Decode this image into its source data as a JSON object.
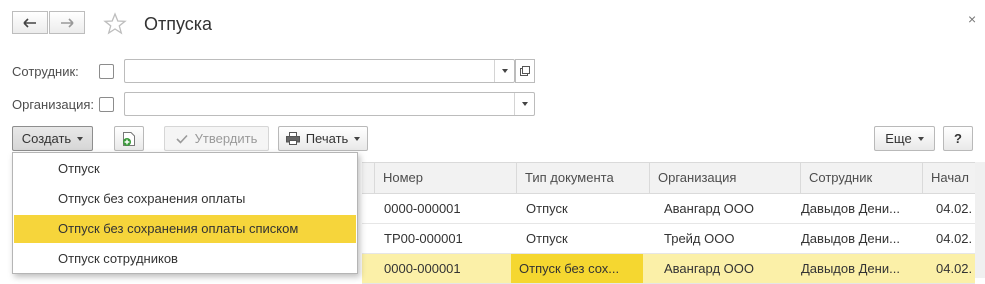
{
  "window": {
    "title": "Отпуска",
    "back_icon": "arrow-left-icon",
    "forward_icon": "arrow-right-icon",
    "favorite_icon": "star-icon",
    "close_label": "×"
  },
  "filters": {
    "employee_label": "Сотрудник:",
    "employee_value": "",
    "organization_label": "Организация:",
    "organization_value": ""
  },
  "toolbar": {
    "create_label": "Создать",
    "approve_label": "Утвердить",
    "print_label": "Печать",
    "more_label": "Еще",
    "help_label": "?"
  },
  "create_menu": {
    "items": [
      {
        "label": "Отпуск",
        "highlighted": false
      },
      {
        "label": "Отпуск без сохранения оплаты",
        "highlighted": false
      },
      {
        "label": "Отпуск без сохранения оплаты списком",
        "highlighted": true
      },
      {
        "label": "Отпуск сотрудников",
        "highlighted": false
      }
    ]
  },
  "table": {
    "columns": [
      "Номер",
      "Тип документа",
      "Организация",
      "Сотрудник",
      "Начал"
    ],
    "rows": [
      [
        "0000-000001",
        "Отпуск",
        "Авангард ООО",
        "Давыдов Дени...",
        "04.02."
      ],
      [
        "ТР00-000001",
        "Отпуск",
        "Трейд ООО",
        "Давыдов Дени...",
        "04.02."
      ],
      [
        "0000-000001",
        "Отпуск без сох...",
        "Авангард ООО",
        "Давыдов Дени...",
        "04.02."
      ]
    ],
    "selected_row": 2
  },
  "colors": {
    "highlight": "#f6d53b",
    "selected_row": "#fbf0a8",
    "focused_cell": "#f5d730",
    "approve_check": "#9a9a9a",
    "add_icon_green": "#3a9a3a"
  }
}
